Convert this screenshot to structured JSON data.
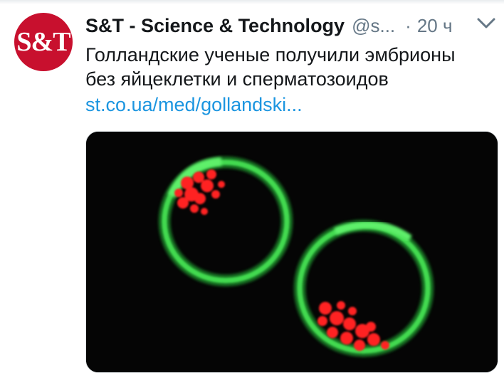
{
  "tweet": {
    "avatar_text": "S&T",
    "display_name": "S&T - Science & Technology",
    "handle": "@s...",
    "separator": "·",
    "time": "20 ч",
    "text_line1": "Голландские ученые получили эмбрионы",
    "text_line2": "без яйцеклетки и сперматозоидов",
    "link": "st.co.ua/med/gollandski..."
  },
  "colors": {
    "link": "#1b95e0",
    "brand_red": "#c8102e",
    "muted": "#657786"
  },
  "icons": {
    "caret": "chevron-down-icon"
  }
}
